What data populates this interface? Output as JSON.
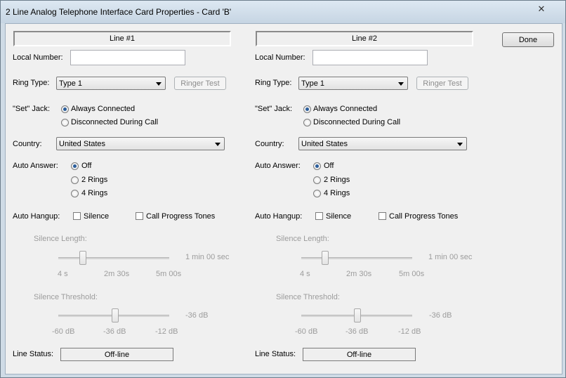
{
  "window": {
    "title": "2 Line Analog Telephone Interface Card Properties - Card 'B'",
    "close_glyph": "✕"
  },
  "done_label": "Done",
  "labels": {
    "local_number": "Local Number:",
    "ring_type": "Ring Type:",
    "set_jack": "\"Set\" Jack:",
    "country": "Country:",
    "auto_answer": "Auto Answer:",
    "auto_hangup": "Auto Hangup:",
    "silence_length": "Silence Length:",
    "silence_threshold": "Silence Threshold:",
    "line_status": "Line Status:"
  },
  "options": {
    "always_connected": "Always Connected",
    "disconnected_during_call": "Disconnected During Call",
    "off": "Off",
    "two_rings": "2 Rings",
    "four_rings": "4 Rings",
    "silence": "Silence",
    "call_progress_tones": "Call Progress Tones",
    "ringer_test": "Ringer Test"
  },
  "slider_ticks": {
    "length": [
      "4 s",
      "2m 30s",
      "5m 00s"
    ],
    "threshold": [
      "-60 dB",
      "-36 dB",
      "-12 dB"
    ]
  },
  "lines": [
    {
      "header": "Line #1",
      "local_number": "",
      "ring_type": "Type 1",
      "set_jack": "always_connected",
      "country": "United States",
      "auto_answer": "off",
      "silence_checked": false,
      "cpt_checked": false,
      "silence_length_value": "1 min 00 sec",
      "silence_threshold_value": "-36 dB",
      "line_status": "Off-line"
    },
    {
      "header": "Line #2",
      "local_number": "",
      "ring_type": "Type 1",
      "set_jack": "always_connected",
      "country": "United States",
      "auto_answer": "off",
      "silence_checked": false,
      "cpt_checked": false,
      "silence_length_value": "1 min 00 sec",
      "silence_threshold_value": "-36 dB",
      "line_status": "Off-line"
    }
  ]
}
